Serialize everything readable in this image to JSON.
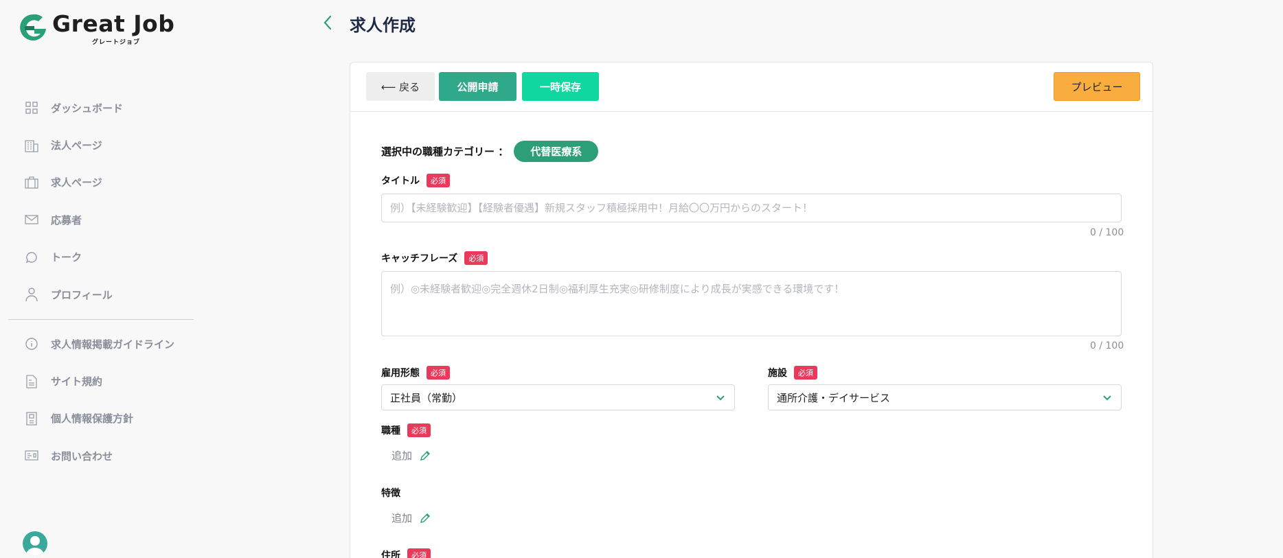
{
  "logo": {
    "text": "Great Job",
    "sub": "グレートジョブ"
  },
  "sidebar": {
    "items": [
      {
        "label": "ダッシュボード",
        "icon": "grid-icon"
      },
      {
        "label": "法人ページ",
        "icon": "building-icon"
      },
      {
        "label": "求人ページ",
        "icon": "briefcase-icon"
      },
      {
        "label": "応募者",
        "icon": "mail-icon"
      },
      {
        "label": "トーク",
        "icon": "chat-bubble-icon"
      },
      {
        "label": "プロフィール",
        "icon": "user-icon"
      }
    ],
    "items2": [
      {
        "label": "求人情報掲載ガイドライン",
        "icon": "info-icon"
      },
      {
        "label": "サイト規約",
        "icon": "document-icon"
      },
      {
        "label": "個人情報保護方針",
        "icon": "clipboard-icon"
      },
      {
        "label": "お問い合わせ",
        "icon": "contact-card-icon"
      }
    ]
  },
  "header": {
    "title": "求人作成"
  },
  "toolbar": {
    "back_label": "⟵ 戻る",
    "apply_label": "公開申請",
    "save_label": "一時保存",
    "preview_label": "プレビュー"
  },
  "form": {
    "category_label": "選択中の職種カテゴリー ：",
    "category_value": "代替医療系",
    "required_badge": "必須",
    "title": {
      "label": "タイトル",
      "placeholder": "例）【未経験歓迎】【経験者優遇】新規スタッフ積極採用中！月給〇〇万円からのスタート！",
      "counter": "0 / 100"
    },
    "catchphrase": {
      "label": "キャッチフレーズ",
      "placeholder": "例）◎未経験者歓迎◎完全週休2日制◎福利厚生充実◎研修制度により成長が実感できる環境です！",
      "counter": "0 / 100"
    },
    "employment": {
      "label": "雇用形態",
      "value": "正社員（常勤）"
    },
    "facility": {
      "label": "施設",
      "value": "通所介護・デイサービス"
    },
    "job_type": {
      "label": "職種",
      "add_label": "追加"
    },
    "features": {
      "label": "特徴",
      "add_label": "追加"
    },
    "address": {
      "label": "住所"
    }
  },
  "colors": {
    "accent_green": "#2fa98a",
    "bright_green": "#10d6a0",
    "preview_orange": "#f8ad3e",
    "required_red": "#ea3a5c"
  }
}
